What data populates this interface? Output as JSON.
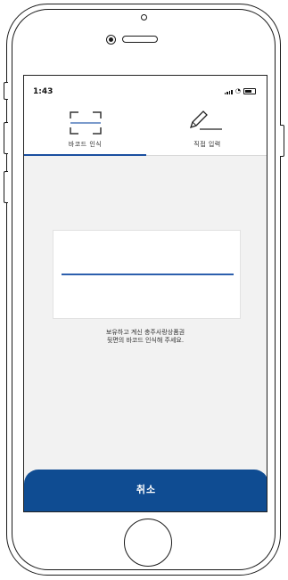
{
  "status_bar": {
    "time": "1:43"
  },
  "tabs": [
    {
      "label": "바코드 인식",
      "icon": "barcode-scan-icon",
      "active": true
    },
    {
      "label": "직접 입력",
      "icon": "pencil-icon",
      "active": false
    }
  ],
  "instruction": {
    "line1": "보유하고 계신 충주사랑상품권",
    "line2": "뒷면의 바코드 인식해 주세요."
  },
  "cancel_button": {
    "label": "취소"
  },
  "colors": {
    "accent": "#1a4fa0",
    "button": "#0f4c92",
    "background": "#f2f2f2"
  }
}
